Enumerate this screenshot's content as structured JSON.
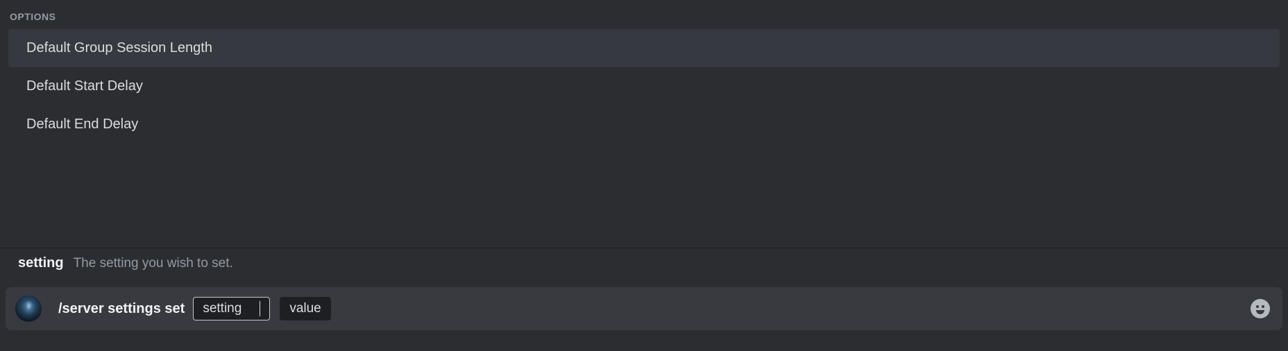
{
  "options": {
    "header": "OPTIONS",
    "items": [
      {
        "label": "Default Group Session Length",
        "selected": true
      },
      {
        "label": "Default Start Delay",
        "selected": false
      },
      {
        "label": "Default End Delay",
        "selected": false
      }
    ]
  },
  "param": {
    "name": "setting",
    "description": "The setting you wish to set."
  },
  "input": {
    "command": "/server settings set",
    "pills": [
      {
        "label": "setting",
        "active": true
      },
      {
        "label": "value",
        "active": false
      }
    ]
  }
}
